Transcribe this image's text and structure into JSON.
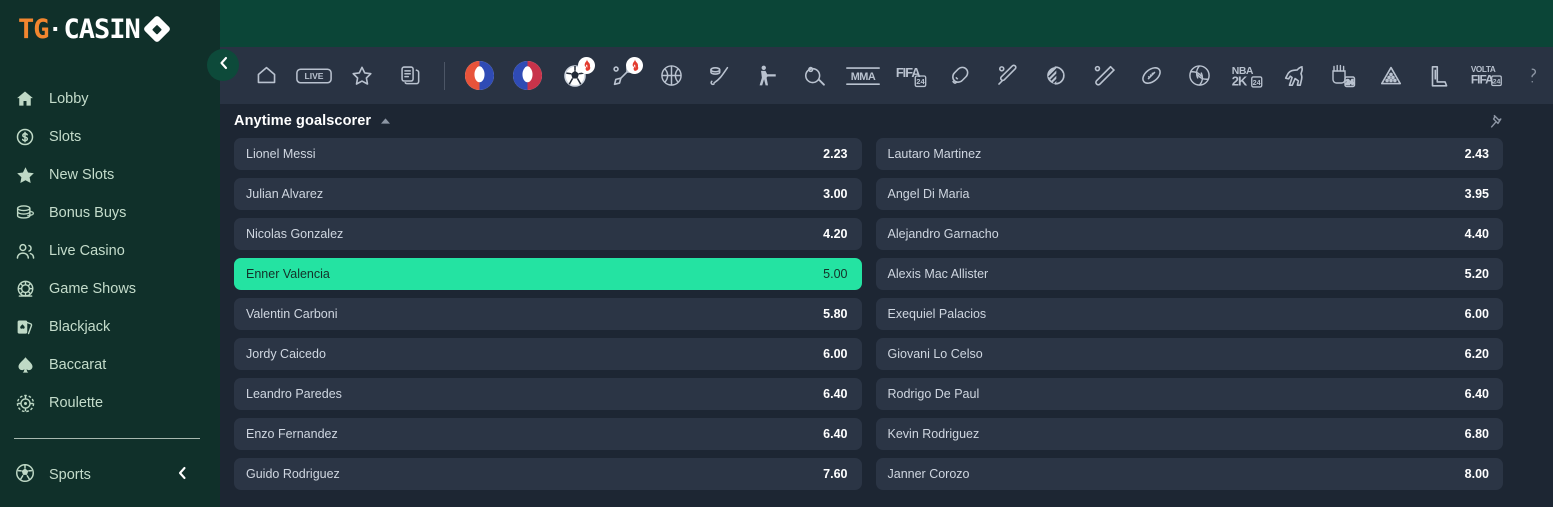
{
  "brand": {
    "logo_tg": "TG",
    "logo_dot": "·",
    "logo_casino": "CASIN",
    "accent_orange": "#f2862f",
    "sidebar_bg": "#10302a",
    "topbar_bg": "#0b4537",
    "content_bg": "#1d2633",
    "row_bg": "#2b3545",
    "selected_green": "#24e3a2"
  },
  "sidebar": {
    "collapse_button": "chevron-left-icon",
    "items": [
      {
        "label": "Lobby",
        "icon": "home-icon"
      },
      {
        "label": "Slots",
        "icon": "dollar-coin-icon"
      },
      {
        "label": "New Slots",
        "icon": "star-icon"
      },
      {
        "label": "Bonus Buys",
        "icon": "coins-stack-icon"
      },
      {
        "label": "Live Casino",
        "icon": "people-icon"
      },
      {
        "label": "Game Shows",
        "icon": "wheel-icon"
      },
      {
        "label": "Blackjack",
        "icon": "cards-icon"
      },
      {
        "label": "Baccarat",
        "icon": "spade-icon"
      },
      {
        "label": "Roulette",
        "icon": "roulette-icon"
      }
    ],
    "sports": {
      "label": "Sports",
      "icon": "soccer-ball-icon",
      "chevron": "chevron-left-icon"
    }
  },
  "sportstrip": {
    "icons": [
      {
        "name": "home-icon",
        "badge": false
      },
      {
        "name": "live-icon",
        "badge": false
      },
      {
        "name": "star-icon",
        "badge": false
      },
      {
        "name": "betslip-icon",
        "badge": false
      },
      {
        "name": "separator",
        "badge": false
      },
      {
        "name": "copa-america-icon",
        "badge": false
      },
      {
        "name": "euro-cup-icon",
        "badge": false
      },
      {
        "name": "soccer-icon",
        "badge": true
      },
      {
        "name": "darts-icon",
        "badge": true
      },
      {
        "name": "basketball-icon",
        "badge": false
      },
      {
        "name": "ice-hockey-icon",
        "badge": false
      },
      {
        "name": "counter-strike-icon",
        "badge": false
      },
      {
        "name": "table-tennis-icon",
        "badge": false
      },
      {
        "name": "mma-icon",
        "badge": false
      },
      {
        "name": "fifa-icon",
        "badge": false
      },
      {
        "name": "boxing-icon",
        "badge": false
      },
      {
        "name": "cricket-icon",
        "badge": false
      },
      {
        "name": "dota-icon",
        "badge": false
      },
      {
        "name": "baseball-icon",
        "badge": false
      },
      {
        "name": "rugby-icon",
        "badge": false
      },
      {
        "name": "volleyball-icon",
        "badge": false
      },
      {
        "name": "nba2k-icon",
        "badge": false
      },
      {
        "name": "horse-racing-icon",
        "badge": false
      },
      {
        "name": "handball-icon",
        "badge": false
      },
      {
        "name": "snooker-icon",
        "badge": false
      },
      {
        "name": "lol-icon",
        "badge": false
      },
      {
        "name": "volta-fifa-icon",
        "badge": false
      },
      {
        "name": "partial-icon",
        "badge": false
      }
    ],
    "badge_icon": "fire-icon",
    "mma_label": "MMA",
    "fifa_label": "FIFA",
    "fifa_sub": "24",
    "nba_label": "NBA",
    "nba_sub": "2K",
    "nba_year": "24",
    "volta_label": "VOLTA",
    "live_label": "LIVE"
  },
  "market": {
    "title": "Anytime goalscorer",
    "sort_caret": "caret-up-icon",
    "pin_icon": "pin-icon"
  },
  "bets": [
    {
      "name": "Lionel Messi",
      "odds": "2.23",
      "selected": false
    },
    {
      "name": "Lautaro Martinez",
      "odds": "2.43",
      "selected": false
    },
    {
      "name": "Julian Alvarez",
      "odds": "3.00",
      "selected": false
    },
    {
      "name": "Angel Di Maria",
      "odds": "3.95",
      "selected": false
    },
    {
      "name": "Nicolas Gonzalez",
      "odds": "4.20",
      "selected": false
    },
    {
      "name": "Alejandro Garnacho",
      "odds": "4.40",
      "selected": false
    },
    {
      "name": "Enner Valencia",
      "odds": "5.00",
      "selected": true
    },
    {
      "name": "Alexis Mac Allister",
      "odds": "5.20",
      "selected": false
    },
    {
      "name": "Valentin Carboni",
      "odds": "5.80",
      "selected": false
    },
    {
      "name": "Exequiel Palacios",
      "odds": "6.00",
      "selected": false
    },
    {
      "name": "Jordy Caicedo",
      "odds": "6.00",
      "selected": false
    },
    {
      "name": "Giovani Lo Celso",
      "odds": "6.20",
      "selected": false
    },
    {
      "name": "Leandro Paredes",
      "odds": "6.40",
      "selected": false
    },
    {
      "name": "Rodrigo De Paul",
      "odds": "6.40",
      "selected": false
    },
    {
      "name": "Enzo Fernandez",
      "odds": "6.40",
      "selected": false
    },
    {
      "name": "Kevin Rodriguez",
      "odds": "6.80",
      "selected": false
    },
    {
      "name": "Guido Rodriguez",
      "odds": "7.60",
      "selected": false
    },
    {
      "name": "Janner Corozo",
      "odds": "8.00",
      "selected": false
    }
  ]
}
